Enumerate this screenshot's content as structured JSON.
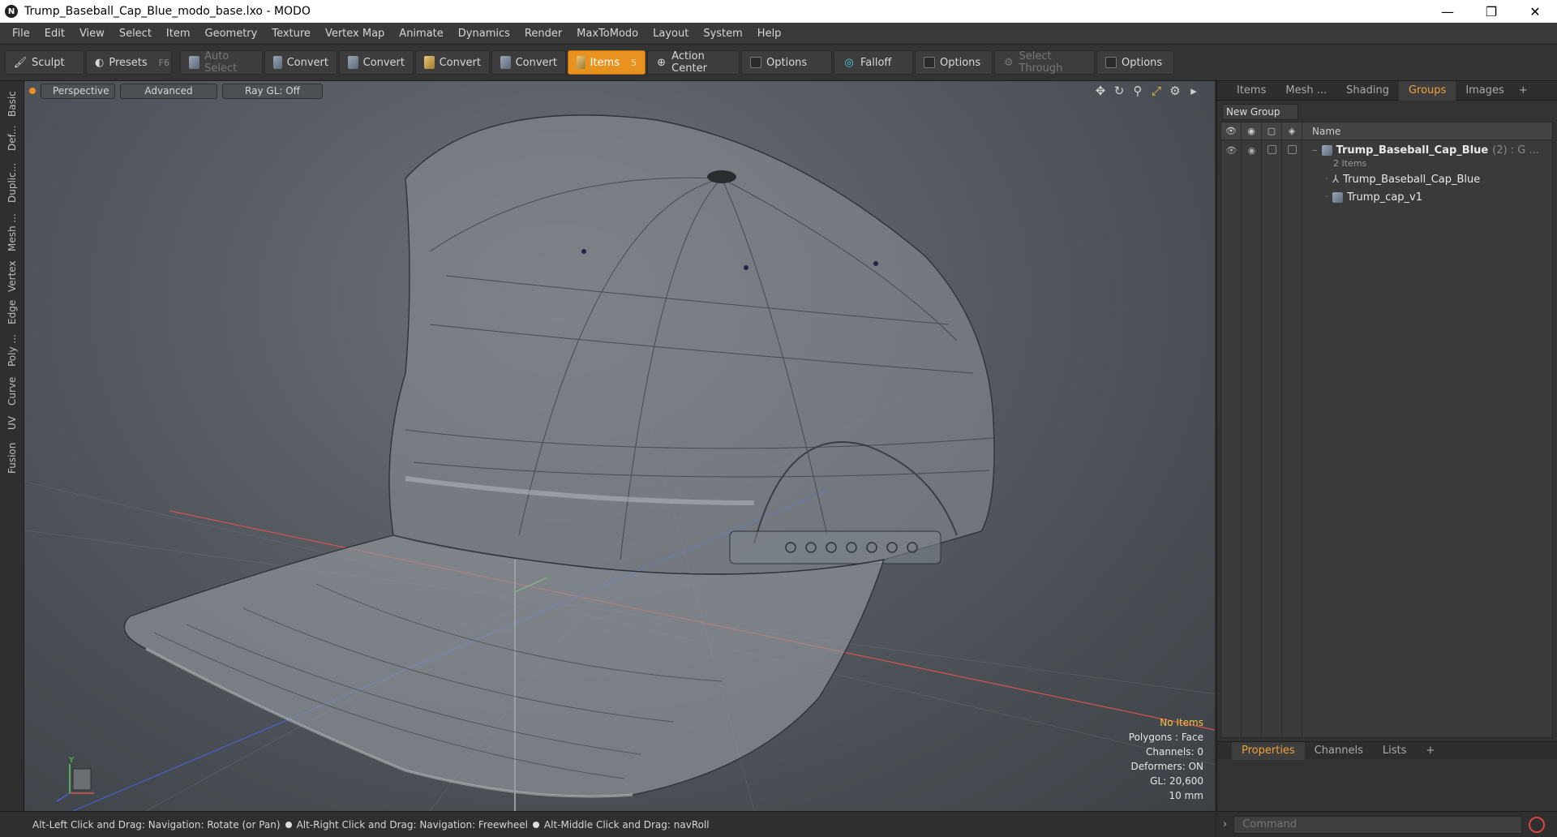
{
  "window": {
    "title": "Trump_Baseball_Cap_Blue_modo_base.lxo - MODO",
    "minimize": "—",
    "maximize": "❐",
    "close": "✕"
  },
  "menu": [
    "File",
    "Edit",
    "View",
    "Select",
    "Item",
    "Geometry",
    "Texture",
    "Vertex Map",
    "Animate",
    "Dynamics",
    "Render",
    "MaxToModo",
    "Layout",
    "System",
    "Help"
  ],
  "toolbar": {
    "sculpt": "Sculpt",
    "presets": "Presets",
    "presets_key": "F6",
    "auto_select": "Auto Select",
    "convert": "Convert",
    "items": "Items",
    "items_key": "5",
    "action_center": "Action Center",
    "options": "Options",
    "falloff": "Falloff",
    "select_through": "Select Through"
  },
  "left_tabs": [
    "Basic",
    "Def...",
    "Duplic...",
    "Mesh ...",
    "Vertex",
    "Edge",
    "Poly ...",
    "Curve",
    "UV",
    "Fusion"
  ],
  "viewport": {
    "view": "Perspective",
    "shading": "Advanced",
    "raygl": "Ray GL: Off",
    "info": {
      "items": "No Items",
      "polygons": "Polygons : Face",
      "channels": "Channels: 0",
      "deformers": "Deformers: ON",
      "gl": "GL: 20,600",
      "scale": "10 mm"
    },
    "axis_y": "Y"
  },
  "right_panel": {
    "tabs": [
      "Items",
      "Mesh ...",
      "Shading",
      "Groups",
      "Images"
    ],
    "active_tab": "Groups",
    "new_group": "New Group",
    "name_header": "Name",
    "group": {
      "name": "Trump_Baseball_Cap_Blue",
      "meta": "(2) : G ...",
      "count": "2 Items",
      "children": [
        "Trump_Baseball_Cap_Blue",
        "Trump_cap_v1"
      ]
    },
    "bottom_tabs": [
      "Properties",
      "Channels",
      "Lists"
    ]
  },
  "status": {
    "hint1": "Alt-Left Click and Drag: Navigation: Rotate (or Pan)",
    "hint2": "Alt-Right Click and Drag: Navigation: Freewheel",
    "hint3": "Alt-Middle Click and Drag: navRoll"
  },
  "command": {
    "placeholder": "Command"
  },
  "colors": {
    "accent": "#e8931f",
    "tab_active": "#f0a23a",
    "axis_x": "#d9534f",
    "axis_z": "#4a5fd0",
    "axis_y": "#5fd05f"
  }
}
